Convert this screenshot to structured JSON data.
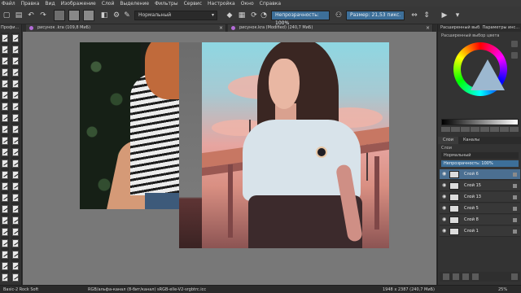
{
  "menu": [
    "Файл",
    "Правка",
    "Вид",
    "Изображение",
    "Слой",
    "Выделение",
    "Фильтры",
    "Сервис",
    "Настройка",
    "Окно",
    "Справка"
  ],
  "toolbar": {
    "blend_mode": "Нормальный",
    "opacity_label": "Непрозрачность: 100%",
    "size_label": "Размер: 21,53 пикс."
  },
  "toolbox": {
    "title": "Профи..."
  },
  "tabs": [
    {
      "label": "рисунок .kra (109,8 МиБ)"
    },
    {
      "label": "рисунок.kra (Modified) (240,7 МиБ)"
    }
  ],
  "docker": {
    "tabs": [
      "Расширенный выб...",
      "Параметры инс..."
    ],
    "subtitle": "Расширенный выбор цвета"
  },
  "layers_panel": {
    "tabs": [
      "Слои",
      "Каналы"
    ],
    "label": "Слои",
    "blend": "Нормальный",
    "opacity": "Непрозрачность: 100%",
    "layers": [
      {
        "name": "Слой 6",
        "active": true
      },
      {
        "name": "Слой 15",
        "active": false
      },
      {
        "name": "Слой 13",
        "active": false
      },
      {
        "name": "Слой 5",
        "active": false
      },
      {
        "name": "Слой 8",
        "active": false
      },
      {
        "name": "Слой 1",
        "active": false
      }
    ]
  },
  "status": {
    "brush": "Basic-2 Rock Soft",
    "colorspace": "RGB/альфа-канал (8-бит/канал)  sRGB-elle-V2-srgbtrc.icc",
    "dimensions": "1948 x 2387 (240,7 МиБ)",
    "zoom": "25%"
  },
  "colors": {
    "accent": "#3d6f99",
    "active_layer": "#4b6f91",
    "canvas_bg": "#787878"
  }
}
